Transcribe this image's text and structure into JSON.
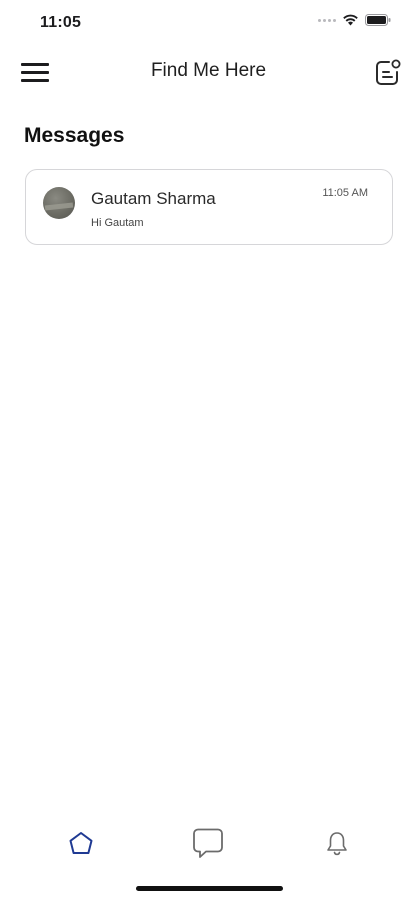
{
  "status_bar": {
    "time": "11:05"
  },
  "header": {
    "title": "Find Me Here"
  },
  "messages": {
    "heading": "Messages",
    "items": [
      {
        "name": "Gautam Sharma",
        "time": "11:05 AM",
        "preview": "Hi Gautam"
      }
    ]
  },
  "tab_bar": {
    "active_tab": "home",
    "active_color": "#1f3a93",
    "inactive_color": "#6b6b6b",
    "icons": [
      "home-icon",
      "chat-bubble-icon",
      "bell-icon"
    ]
  }
}
